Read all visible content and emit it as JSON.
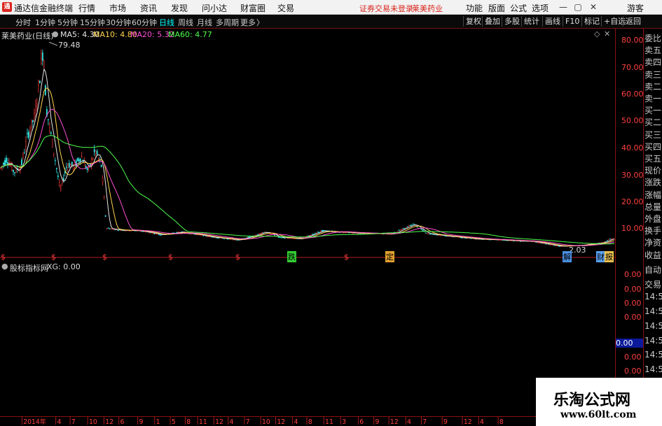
{
  "titlebar": {
    "app_name": "通达信金融终端",
    "menu": [
      "行情",
      "市场",
      "资讯",
      "发现",
      "问小达",
      "财富圈",
      "交易"
    ],
    "status": "证券交易未登录",
    "stock": "莱美药业",
    "right_menu": [
      "功能",
      "版面",
      "公式",
      "选项"
    ],
    "guest": "游客",
    "window_controls": [
      "minimize-icon",
      "restore-icon",
      "close-icon"
    ]
  },
  "toolbar": {
    "periods": [
      "分时",
      "1分钟",
      "5分钟",
      "15分钟",
      "30分钟",
      "60分钟",
      "日线",
      "周线",
      "月线",
      "多周期",
      "更多"
    ],
    "active_period": "日线",
    "more_glyph": "〉",
    "right_buttons": [
      "复权",
      "叠加",
      "多股",
      "统计",
      "画线",
      "F10",
      "标记",
      "+自选",
      "返回"
    ]
  },
  "main_panel": {
    "title": "莱美药业(日线)",
    "ma": [
      {
        "label": "MA5: 4.30",
        "color": "#e6e6e6"
      },
      {
        "label": "MA10: 4.80",
        "color": "#ffd34d"
      },
      {
        "label": "MA20: 5.32",
        "color": "#ff4fd8"
      },
      {
        "label": "MA60: 4.77",
        "color": "#4dff4d"
      }
    ],
    "peak_label": "79.48",
    "low_label": "2.03",
    "y_ticks": [
      "80.00",
      "70.00",
      "60.00",
      "50.00",
      "40.00",
      "30.00",
      "20.00",
      "10.00"
    ],
    "event_markers": [
      "$",
      "$",
      "$",
      "$",
      "$",
      "跌",
      "$",
      "定",
      "解",
      "财",
      "报"
    ]
  },
  "sub_panel": {
    "title": "股标指标网",
    "xg": "XG: 0.00",
    "y_ticks": [
      "0.00",
      "0.00",
      "0.00",
      "0.00",
      "0.00",
      "0.00",
      "0.00"
    ],
    "highlight": "0.00"
  },
  "right_panel": {
    "red_label": "R",
    "items": [
      "委比",
      "卖五",
      "卖四",
      "卖三",
      "卖二",
      "卖一",
      "买一",
      "买二",
      "买三",
      "买四",
      "买五",
      "现价",
      "涨跌",
      "涨幅",
      "总量",
      "外盘",
      "换手",
      "净资",
      "收益",
      "自动",
      "交易",
      "14:56",
      "14:56",
      "14:56",
      "14:56",
      "14:56",
      "14:56",
      "14:56",
      "14:56"
    ]
  },
  "bottom_axis": {
    "labels": [
      "2014年",
      "4",
      "7",
      "10",
      "12",
      "6",
      "9",
      "1",
      "5",
      "8",
      "11",
      "12",
      "4",
      "7",
      "10",
      "12",
      "4",
      "8",
      "11",
      "3",
      "6",
      "9",
      "12",
      "4",
      "7",
      "9",
      "12",
      "4",
      "8"
    ]
  },
  "watermark": {
    "title": "乐淘公式网",
    "url": "www.60lt.com"
  },
  "colors": {
    "up": "#ff3b3b",
    "down": "#33e6e6",
    "axis": "#b81a1a",
    "price_axis_text": "#ff4040"
  }
}
